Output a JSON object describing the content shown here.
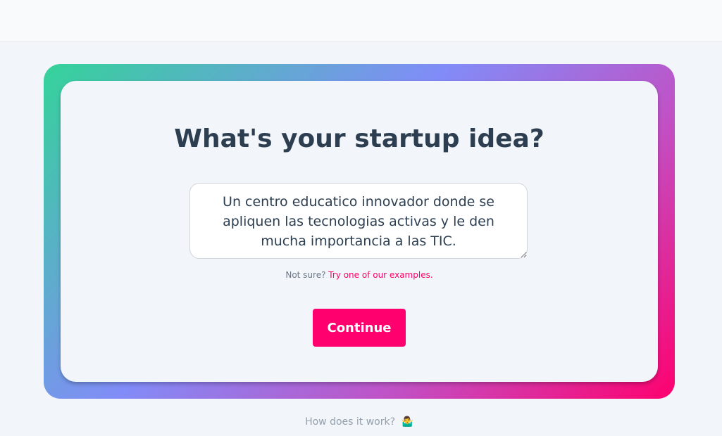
{
  "header": {},
  "card": {
    "title": "What's your startup idea?",
    "idea_value": "Un centro educatico innovador donde se apliquen las tecnologias activas y le den mucha importancia a las TIC.",
    "hint_prefix": "Not sure?",
    "hint_link": "Try one of our examples.",
    "continue_label": "Continue"
  },
  "footer": {
    "how_label": "How does it work?",
    "how_icon": "person-shrugging-icon",
    "how_emoji": "🤷‍♂️"
  },
  "colors": {
    "accent": "#ff006e",
    "gradient_start": "#34d399",
    "gradient_mid": "#818cf8",
    "gradient_end": "#ff006e",
    "title": "#2c3e50"
  }
}
